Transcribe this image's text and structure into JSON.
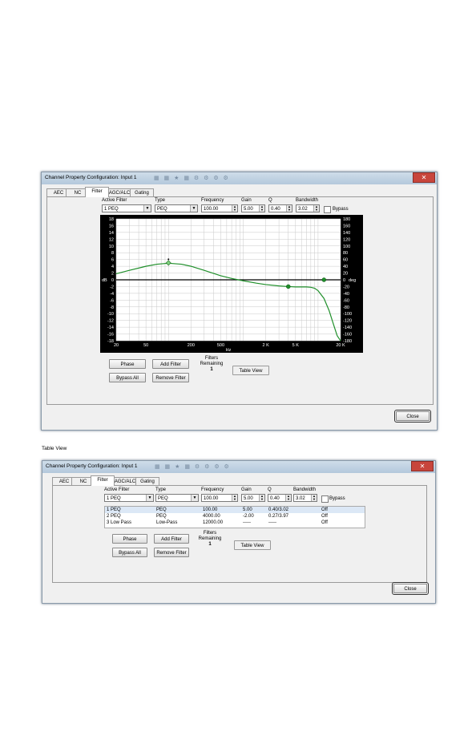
{
  "window": {
    "title": "Channel Property Configuration: Input 1",
    "close_glyph": "✕",
    "icons": [
      "grid-icon",
      "grid-icon",
      "star-icon",
      "grid-icon",
      "gear-icon",
      "gear-icon",
      "gear-icon",
      "gear-icon"
    ]
  },
  "tabs": [
    "AEC",
    "NC",
    "Filter",
    "AGC/ALC",
    "Gating"
  ],
  "active_tab": "Filter",
  "controls": {
    "active_filter": {
      "label": "Active Filter",
      "value": "1 PEQ"
    },
    "type": {
      "label": "Type",
      "value": "PEQ"
    },
    "frequency": {
      "label": "Frequency",
      "value": "100.00"
    },
    "gain": {
      "label": "Gain",
      "value": "5.00"
    },
    "q": {
      "label": "Q",
      "value": "0.40"
    },
    "bandwidth": {
      "label": "Bandwidth",
      "value": "3.02"
    },
    "bypass": {
      "label": "Bypass",
      "checked": false
    }
  },
  "buttons": {
    "phase": "Phase",
    "bypass_all": "Bypass All",
    "add_filter": "Add Filter",
    "remove_filter": "Remove Filter",
    "table_view": "Table View",
    "close": "Close"
  },
  "filters_remaining": {
    "label_line1": "Filters",
    "label_line2": "Remaining",
    "value": "1"
  },
  "caption": "Table View",
  "chart_data": {
    "type": "line",
    "x_scale": "log",
    "xlim": [
      20,
      20000
    ],
    "ylim": [
      -18,
      18
    ],
    "y2lim": [
      -180,
      180
    ],
    "x_tick_labels": [
      "20",
      "50",
      "200",
      "500",
      "2 K",
      "5 K",
      "20 K"
    ],
    "x_tick_values": [
      20,
      50,
      200,
      500,
      2000,
      5000,
      20000
    ],
    "xlabel": "Hz",
    "ylabel": "dB",
    "y2label": "deg",
    "y_ticks": [
      18,
      16,
      14,
      12,
      10,
      8,
      6,
      4,
      2,
      0,
      -2,
      -4,
      -6,
      -8,
      -10,
      -12,
      -14,
      -16,
      -18
    ],
    "y2_ticks": [
      180,
      160,
      140,
      120,
      100,
      80,
      60,
      40,
      20,
      0,
      -20,
      -40,
      -60,
      -80,
      -100,
      -120,
      -140,
      -160,
      -180
    ],
    "grid": true,
    "colors": {
      "background": "#000000",
      "grid": "#c8c8c8",
      "plot_bg": "#ffffff",
      "curve": "#1f8f2a",
      "zero_line": "#000000"
    },
    "series": [
      {
        "values_x": [
          20,
          30,
          50,
          70,
          100,
          150,
          200,
          300,
          500,
          700,
          1000,
          1500,
          2000,
          3000,
          4000,
          5000,
          6000,
          7000,
          8000,
          9000,
          10000,
          12000,
          14000,
          16000,
          18000,
          20000
        ],
        "values_y": [
          1.8,
          2.8,
          4.0,
          4.6,
          4.9,
          4.6,
          4.0,
          2.8,
          1.2,
          0.4,
          -0.3,
          -1.0,
          -1.4,
          -1.8,
          -2.0,
          -2.1,
          -2.1,
          -2.1,
          -2.2,
          -2.5,
          -3.2,
          -5.5,
          -9,
          -13,
          -16.5,
          -18
        ]
      }
    ],
    "handles": [
      {
        "x": 100,
        "y": 5.0,
        "selected": true
      },
      {
        "x": 4000,
        "y": -2.0,
        "selected": false
      },
      {
        "x": 12000,
        "y": 0,
        "selected": false
      }
    ]
  },
  "table": {
    "rows": [
      {
        "name": "1 PEQ",
        "type": "PEQ",
        "freq": "100.00",
        "gain": "5.00",
        "q": "0.40/3.02",
        "status": "Off"
      },
      {
        "name": "2 PEQ",
        "type": "PEQ",
        "freq": "4000.00",
        "gain": "-2.00",
        "q": "0.27/3.97",
        "status": "Off"
      },
      {
        "name": "3 Low Pass",
        "type": "Low-Pass",
        "freq": "12000.00",
        "gain": "-----",
        "q": "-----",
        "status": "Off"
      }
    ]
  }
}
